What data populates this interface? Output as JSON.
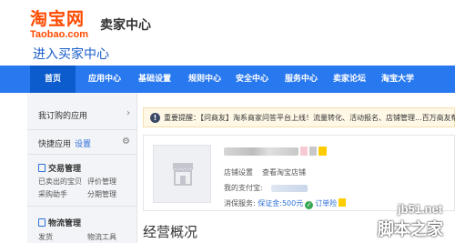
{
  "header": {
    "logo_main": "淘宝网",
    "logo_sub": "Taobao.com",
    "seller_center": "卖家中心",
    "overlay_caption": "进入买家中心"
  },
  "nav": {
    "items": [
      {
        "label": "首页"
      },
      {
        "label": "应用中心"
      },
      {
        "label": "基础设置"
      },
      {
        "label": "规则中心"
      },
      {
        "label": "安全中心"
      },
      {
        "label": "服务中心"
      },
      {
        "label": "卖家论坛"
      },
      {
        "label": "淘宝大学"
      }
    ]
  },
  "sidebar": {
    "my_apps": "我订购的应用",
    "quick_apps": "快捷应用",
    "quick_settings": "设置",
    "groups": [
      {
        "title": "交易管理",
        "links": [
          "已卖出的宝贝",
          "评价管理",
          "采购助手",
          "分期管理"
        ]
      },
      {
        "title": "物流管理",
        "links": [
          "发货",
          "物流工具"
        ]
      }
    ]
  },
  "notice": {
    "text": "重要提醒：【问商友】淘系商家问答平台上线！流量转化、活动报名、店铺管理...百万商友帮"
  },
  "shop": {
    "links": [
      "店铺设置",
      "查看淘宝店铺"
    ],
    "alipay_label": "我的支付宝:",
    "consumer_label": "消保服务:",
    "deposit": "保证金:500元",
    "order_risk": "订单险"
  },
  "main": {
    "section_title": "经营概况"
  },
  "watermark": {
    "url": "jb51.net",
    "name": "脚本之家"
  },
  "colors": {
    "nav_bg": "#2878EF",
    "nav_active": "#0D5CCD",
    "brand_orange": "#FF4A00",
    "link_blue": "#2D6FD8"
  }
}
